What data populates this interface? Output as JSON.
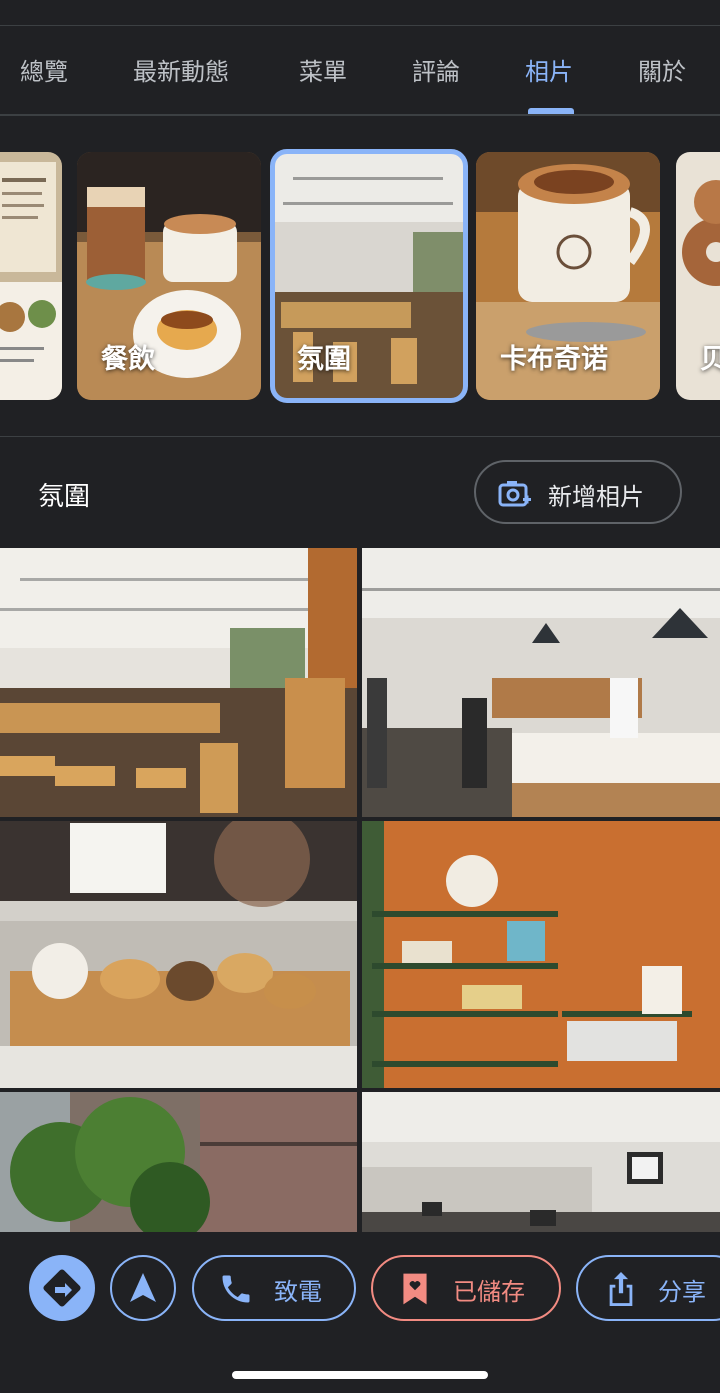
{
  "tabs": [
    {
      "label": "總覽"
    },
    {
      "label": "最新動態"
    },
    {
      "label": "菜單"
    },
    {
      "label": "評論"
    },
    {
      "label": "相片"
    },
    {
      "label": "關於"
    }
  ],
  "categories": [
    {
      "label": ""
    },
    {
      "label": "餐飲"
    },
    {
      "label": "氛圍"
    },
    {
      "label": "卡布奇诺"
    },
    {
      "label": "贝"
    }
  ],
  "section": {
    "title": "氛圍",
    "add_photo_label": "新增相片"
  },
  "actions": {
    "call_label": "致電",
    "saved_label": "已儲存",
    "share_label": "分享"
  },
  "colors": {
    "accent": "#8ab4f8",
    "saved": "#f28b82",
    "background": "#202124"
  }
}
